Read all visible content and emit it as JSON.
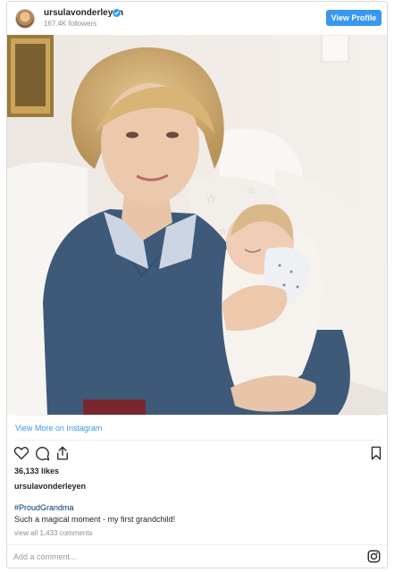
{
  "header": {
    "username": "ursulavonderleyen",
    "followers": "167.4K followers",
    "view_profile_label": "View Profile"
  },
  "links": {
    "view_more": "View More on Instagram"
  },
  "post": {
    "likes": "36,133 likes",
    "caption_user": "ursulavonderleyen",
    "hashtag": "#ProudGrandma",
    "caption": "Such a magical moment - my first grandchild!",
    "comments_link": "view all 1,433 comments"
  },
  "comment": {
    "placeholder": "Add a comment..."
  },
  "icons": [
    "verified-badge-icon",
    "heart-icon",
    "comment-icon",
    "share-icon",
    "bookmark-icon",
    "instagram-icon"
  ],
  "colors": {
    "accent": "#3897f0",
    "hashtag": "#003569",
    "text": "#262626",
    "muted": "#8e8e8e"
  }
}
